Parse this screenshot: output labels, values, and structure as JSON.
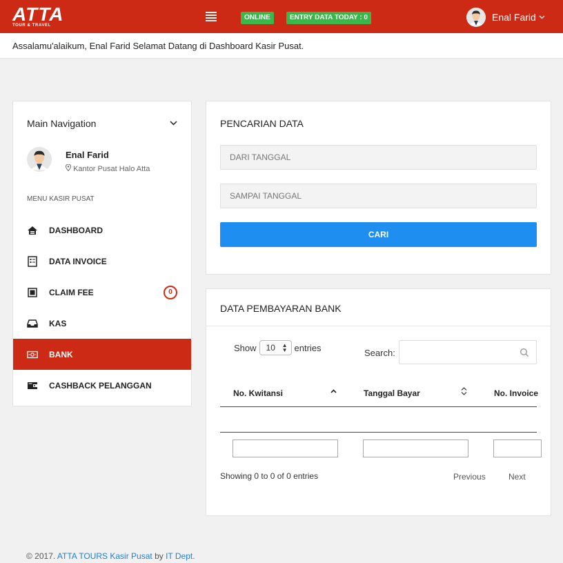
{
  "header": {
    "logo_main": "ATTA",
    "logo_sub": "TOUR & TRAVEL",
    "badge_online": "ONLINE",
    "badge_entry": "ENTRY DATA TODAY : 0",
    "user_name": "Enal Farid"
  },
  "welcome_text": "Assalamu'alaikum, Enal Farid Selamat Datang di Dashboard Kasir Pusat.",
  "sidebar": {
    "title": "Main Navigation",
    "user_name": "Enal Farid",
    "user_location": "Kantor Pusat Halo Atta",
    "section_label": "MENU KASIR PUSAT",
    "items": [
      {
        "label": "DASHBOARD",
        "icon": "home-icon"
      },
      {
        "label": "DATA INVOICE",
        "icon": "invoice-icon"
      },
      {
        "label": "CLAIM FEE",
        "icon": "document-icon",
        "badge": "0"
      },
      {
        "label": "KAS",
        "icon": "inbox-icon"
      },
      {
        "label": "BANK",
        "icon": "money-icon",
        "active": true
      },
      {
        "label": "CASHBACK PELANGGAN",
        "icon": "wallet-icon"
      }
    ]
  },
  "search_panel": {
    "title": "PENCARIAN DATA",
    "from_placeholder": "DARI TANGGAL",
    "to_placeholder": "SAMPAI TANGGAL",
    "button_label": "CARI"
  },
  "table_panel": {
    "title": "DATA PEMBAYARAN BANK",
    "show_label": "Show",
    "entries_value": "10",
    "entries_label": "entries",
    "search_label": "Search:",
    "columns": [
      "No. Kwitansi",
      "Tanggal Bayar",
      "No. Invoice"
    ],
    "info": "Showing 0 to 0 of 0 entries",
    "prev_label": "Previous",
    "next_label": "Next"
  },
  "footer": {
    "prefix": "© 2017.",
    "brand": "ATTA TOURS Kasir Pusat",
    "by": "by",
    "dept": "IT Dept."
  },
  "colors": {
    "brand_red": "#cc2a14",
    "online_green": "#3cb64a",
    "button_blue": "#1e8ff0",
    "link_blue": "#1e7fd8"
  }
}
